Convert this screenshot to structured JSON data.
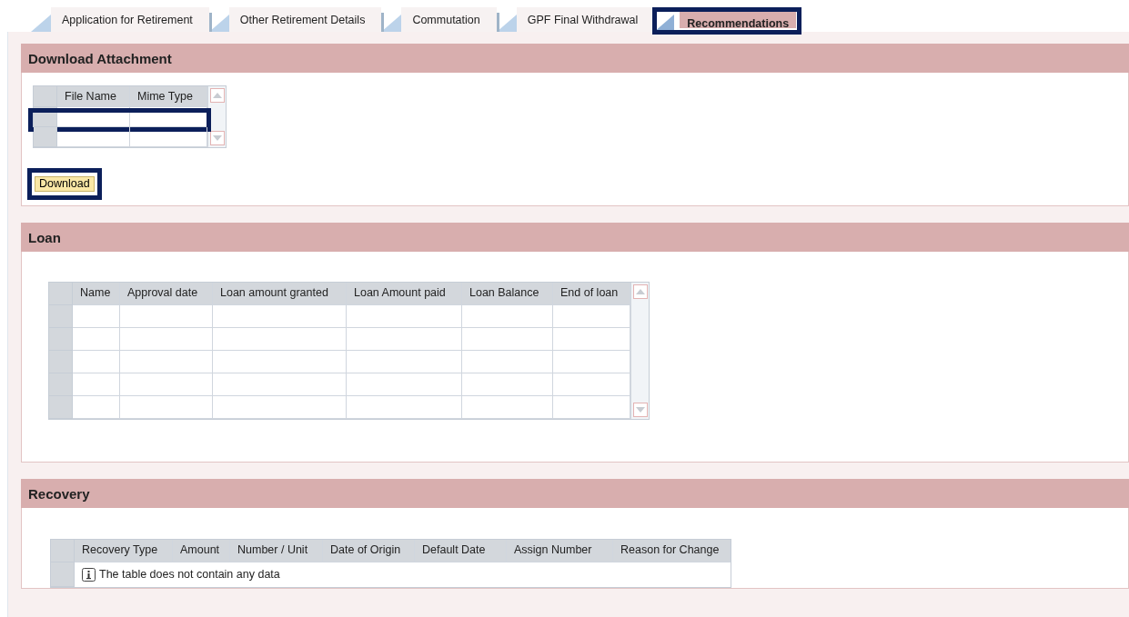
{
  "tabs": [
    {
      "label": "Application for Retirement",
      "selected": false,
      "highlighted": false
    },
    {
      "label": "Other Retirement Details",
      "selected": false,
      "highlighted": false
    },
    {
      "label": "Commutation",
      "selected": false,
      "highlighted": false
    },
    {
      "label": "GPF Final Withdrawal",
      "selected": false,
      "highlighted": false
    },
    {
      "label": "Recommendations",
      "selected": true,
      "highlighted": true
    }
  ],
  "sections": [
    {
      "title": "Download Attachment",
      "kind": "attachment",
      "table": {
        "columns": [
          "File Name",
          "Mime Type"
        ],
        "rows": [
          {
            "highlighted": true
          },
          {
            "highlighted": false
          }
        ]
      },
      "button": {
        "label": "Download",
        "highlighted": true
      }
    },
    {
      "title": "Loan",
      "kind": "grid",
      "table": {
        "columns": [
          "Name",
          "Approval date",
          "Loan amount granted",
          "Loan Amount paid",
          "Loan Balance",
          "End of loan"
        ],
        "rows": [
          {
            "highlighted": false
          },
          {
            "highlighted": false
          },
          {
            "highlighted": false
          },
          {
            "highlighted": false
          },
          {
            "highlighted": false
          }
        ]
      }
    },
    {
      "title": "Recovery",
      "kind": "empty",
      "table": {
        "columns": [
          "Recovery Type",
          "Amount",
          "Number / Unit",
          "Date of Origin",
          "Default Date",
          "Assign Number",
          "Reason for Change"
        ],
        "message": "The table does not contain any data"
      }
    }
  ]
}
